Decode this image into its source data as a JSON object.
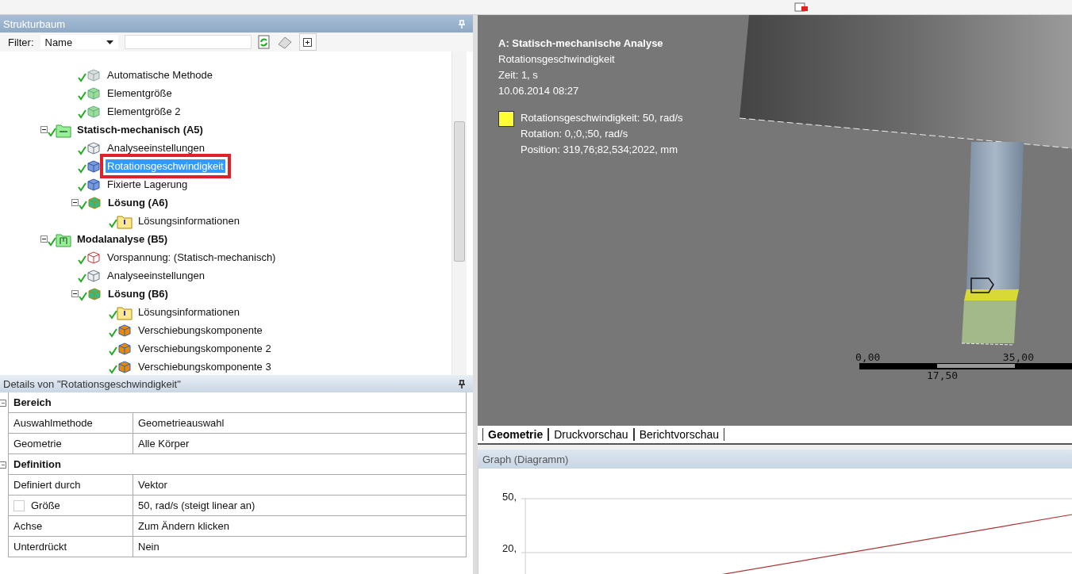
{
  "tree_panel": {
    "title": "Strukturbaum",
    "filter_label": "Filter:",
    "filter_mode": "Name"
  },
  "tree": {
    "upper_items": [
      {
        "label": "Automatische Methode",
        "kind": "method",
        "selected": false
      },
      {
        "label": "Elementgröße",
        "kind": "sizing",
        "selected": false
      },
      {
        "label": "Elementgröße 2",
        "kind": "sizing",
        "selected": false
      }
    ],
    "items": [
      {
        "label": "Statisch-mechanisch (A5)",
        "kind": "static",
        "selected": false,
        "expanded": true,
        "children": [
          {
            "label": "Analyseeinstellungen",
            "kind": "settings",
            "selected": false
          },
          {
            "label": "Rotationsgeschwindigkeit",
            "kind": "rotation",
            "selected": true
          },
          {
            "label": "Fixierte Lagerung",
            "kind": "support",
            "selected": false
          },
          {
            "label": "Lösung (A6)",
            "kind": "solution",
            "selected": false,
            "expanded": true,
            "children": [
              {
                "label": "Lösungsinformationen",
                "kind": "info",
                "selected": false
              }
            ]
          }
        ]
      },
      {
        "label": "Modalanalyse (B5)",
        "kind": "modal",
        "selected": false,
        "expanded": true,
        "children": [
          {
            "label": "Vorspannung: (Statisch-mechanisch)",
            "kind": "prestress",
            "selected": false
          },
          {
            "label": "Analyseeinstellungen",
            "kind": "settings",
            "selected": false
          },
          {
            "label": "Lösung (B6)",
            "kind": "solution",
            "selected": false,
            "expanded": true,
            "children": [
              {
                "label": "Lösungsinformationen",
                "kind": "info",
                "selected": false
              },
              {
                "label": "Verschiebungskomponente",
                "kind": "result",
                "selected": false
              },
              {
                "label": "Verschiebungskomponente 2",
                "kind": "result",
                "selected": false
              },
              {
                "label": "Verschiebungskomponente 3",
                "kind": "result",
                "selected": false
              }
            ]
          }
        ]
      }
    ]
  },
  "details": {
    "title": "Details von \"Rotationsgeschwindigkeit\"",
    "sections": [
      {
        "name": "Bereich",
        "expanded": true,
        "rows": [
          {
            "label": "Auswahlmethode",
            "value": "Geometrieauswahl"
          },
          {
            "label": "Geometrie",
            "value": "Alle Körper"
          }
        ]
      },
      {
        "name": "Definition",
        "expanded": true,
        "rows": [
          {
            "label": "Definiert durch",
            "value": "Vektor"
          },
          {
            "label": "Größe",
            "value": "50, rad/s  (steigt linear an)",
            "kind": "checkbox",
            "checked": false
          },
          {
            "label": "Achse",
            "value": "Zum Ändern klicken"
          },
          {
            "label": "Unterdrückt",
            "value": "Nein"
          }
        ]
      }
    ]
  },
  "viewport": {
    "title": "A: Statisch-mechanische Analyse",
    "lines": [
      "Rotationsgeschwindigkeit",
      "Zeit: 1, s",
      "10.06.2014 08:27"
    ],
    "legend": {
      "color": "#ffff33",
      "lines": [
        "Rotationsgeschwindigkeit: 50, rad/s",
        "Rotation: 0,;0,;50, rad/s",
        "Position: 319,76;82,534;2022, mm"
      ]
    },
    "scale": {
      "start": "0,00",
      "middle": "17,50",
      "end": "35,00"
    }
  },
  "tabs": [
    {
      "label": "Geometrie",
      "selected": true
    },
    {
      "label": "Druckvorschau",
      "selected": false
    },
    {
      "label": "Berichtvorschau",
      "selected": false
    }
  ],
  "graph": {
    "title": "Graph (Diagramm)",
    "y_tick_labels": [
      "50,",
      "20,"
    ]
  }
}
